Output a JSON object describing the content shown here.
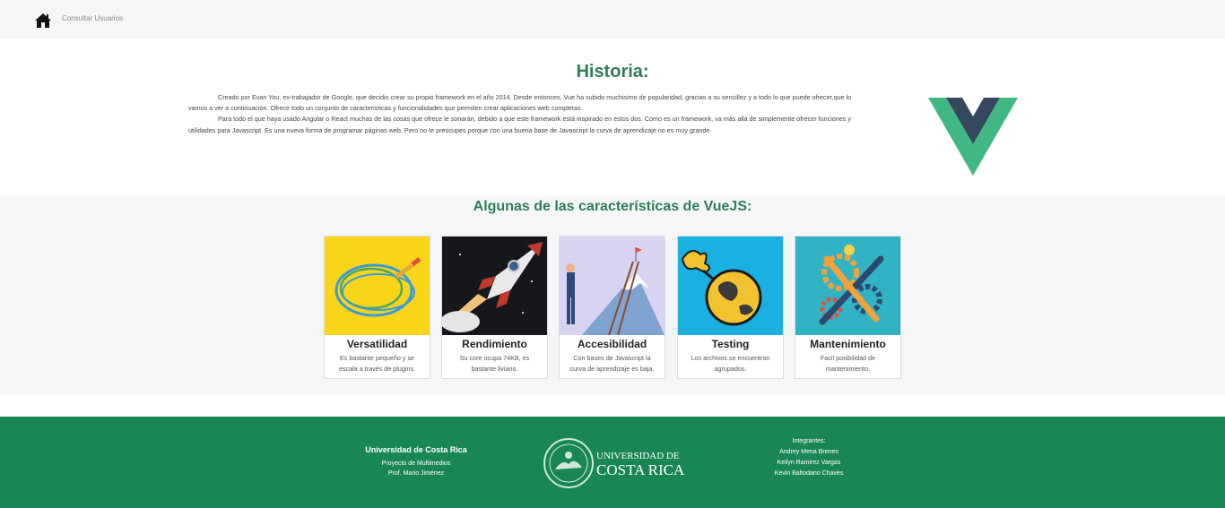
{
  "nav": {
    "link": "Consultar Usuarios"
  },
  "history": {
    "title": "Historia:",
    "paragraphs": [
      "Creado por Evan You, ex-trabajador de Google, que decidio crear su propio framework en el año 2014. Desde entonces, Vue ha subido muchisimo de popularidad, gracias a su sencillez y a todo lo que puede ofrecer,que lo vamos a ver a continuación. Ofrece todo un conjunto de caracteristicas y funcionalidades que permiten crear aplicaciones web completas.",
      "Para todo el que haya usado Angular o React muchas de las cosas que ofrece le sonarán, debido a que este framework está inspirado en estos dos. Como es un framework, va más allá de simplemente ofrecer funciones y utilidades para Javascript. Es una nueva forma de programar páginas web. Pero no te preocupes porque con una buena base de Javascript la curva de aprendizaje no es muy grande."
    ]
  },
  "features": {
    "title": "Algunas de las características de VueJS:",
    "cards": [
      {
        "title": "Versatilidad",
        "desc": "Es bastante pequeño y se escala a través de plugins.",
        "icon": "cable-illustration"
      },
      {
        "title": "Rendimiento",
        "desc": "Su core ocupa 74KB, es bastante liviano.",
        "icon": "rocket-illustration"
      },
      {
        "title": "Accesibilidad",
        "desc": "Con bases de Javascript la curva de aprendizaje es baja.",
        "icon": "ladder-mountain-illustration"
      },
      {
        "title": "Testing",
        "desc": "Los archivos se encuentran agrupados.",
        "icon": "globe-magnifier-illustration"
      },
      {
        "title": "Mantenimiento",
        "desc": "Facil posibilidad de mantenimiento.",
        "icon": "tools-gears-illustration"
      }
    ]
  },
  "footer": {
    "university": "Universidad de Costa Rica",
    "lines": [
      "Proyecto de Multimedios",
      "Prof. Mario Jiménez"
    ],
    "logo_text": [
      "UNIVERSIDAD DE",
      "COSTA RICA"
    ],
    "team_title": "Integrantes:",
    "members": [
      "Andrey Mena Brenes",
      "Keilyn Ramirez Vargas",
      "Kevin Baltodano Chaves"
    ]
  },
  "colors": {
    "accent": "#2e7d57",
    "footer": "#198754",
    "vue_green": "#41b883",
    "vue_dark": "#35495e"
  }
}
